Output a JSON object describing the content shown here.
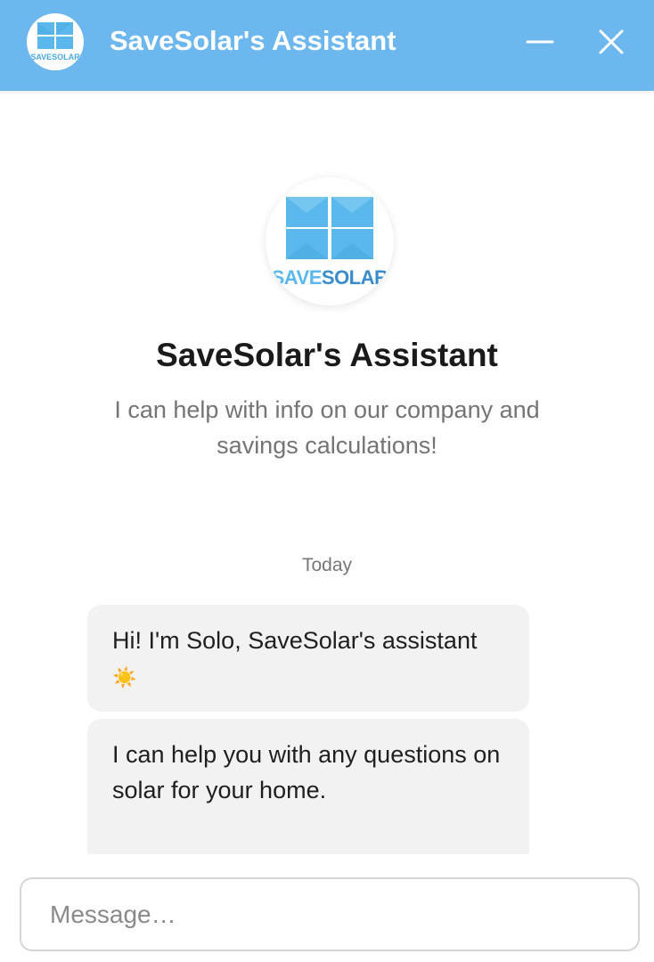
{
  "header": {
    "title": "SaveSolar's Assistant",
    "logo_text": "SAVESOLAR",
    "background_color": "#6db7ef",
    "minimize_icon": "minimize-icon",
    "close_icon": "close-icon"
  },
  "intro": {
    "logo_text_save": "SAVE",
    "logo_text_solar": "SOLAR",
    "title": "SaveSolar's Assistant",
    "subtitle": "I can help with info on our company and savings calculations!"
  },
  "brand": {
    "panel_color": "#5ab8ec",
    "text_color": "#4aa9e0"
  },
  "conversation": {
    "date_label": "Today",
    "messages": [
      {
        "sender": "assistant",
        "text": "Hi! I'm Solo, SaveSolar's assistant",
        "emoji": "☀️"
      },
      {
        "sender": "assistant",
        "text": "I can help you with any questions on solar for your home."
      }
    ]
  },
  "composer": {
    "placeholder": "Message…",
    "value": ""
  }
}
